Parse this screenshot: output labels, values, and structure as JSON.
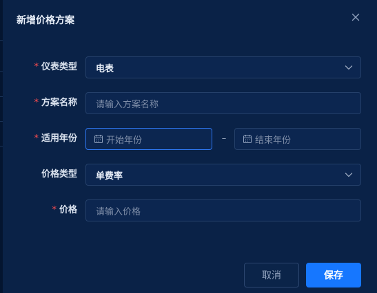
{
  "dialog": {
    "title": "新增价格方案",
    "close_icon": "close-icon"
  },
  "form": {
    "meter_type": {
      "label": "仪表类型",
      "required_mark": "*",
      "value": "电表",
      "icon": "chevron-down-icon"
    },
    "plan_name": {
      "label": "方案名称",
      "required_mark": "*",
      "placeholder": "请输入方案名称"
    },
    "applicable_year": {
      "label": "适用年份",
      "required_mark": "*",
      "start_placeholder": "开始年份",
      "end_placeholder": "结束年份",
      "separator": "–",
      "icon": "calendar-icon"
    },
    "price_type": {
      "label": "价格类型",
      "value": "单费率",
      "icon": "chevron-down-icon"
    },
    "price": {
      "label": "价格",
      "required_mark": "*",
      "placeholder": "请输入价格"
    }
  },
  "footer": {
    "cancel_label": "取消",
    "save_label": "保存"
  },
  "colors": {
    "background": "#0a2247",
    "primary": "#1677ff",
    "required": "#ff4d4f",
    "focus_border": "#2e77f2"
  }
}
